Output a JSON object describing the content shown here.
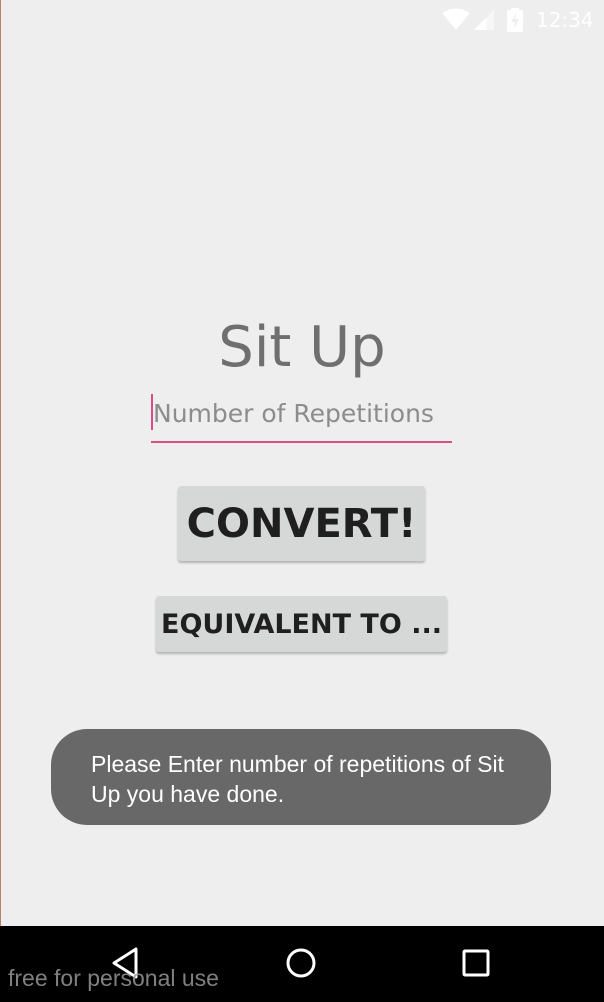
{
  "status_bar": {
    "time": "12:34",
    "icons": [
      "wifi-icon",
      "cell-signal-icon",
      "battery-charging-icon"
    ],
    "icon_color": "#ffffff"
  },
  "main": {
    "title": "Sit Up",
    "repetitions_input": {
      "placeholder": "Number of Repetitions",
      "value": ""
    },
    "convert_label": "CONVERT!",
    "equivalent_label": "EQUIVALENT TO ..."
  },
  "toast": {
    "message": "Please Enter number of repetitions of Sit Up you have done."
  },
  "nav_bar": {
    "icons": [
      "back-icon",
      "home-icon",
      "recents-icon"
    ]
  },
  "watermark": "free for personal use",
  "colors": {
    "background": "#eeeeee",
    "accent": "#d94d84",
    "button_bg": "#d6d7d7",
    "toast_bg": "#686868",
    "nav_bg": "#000000"
  }
}
